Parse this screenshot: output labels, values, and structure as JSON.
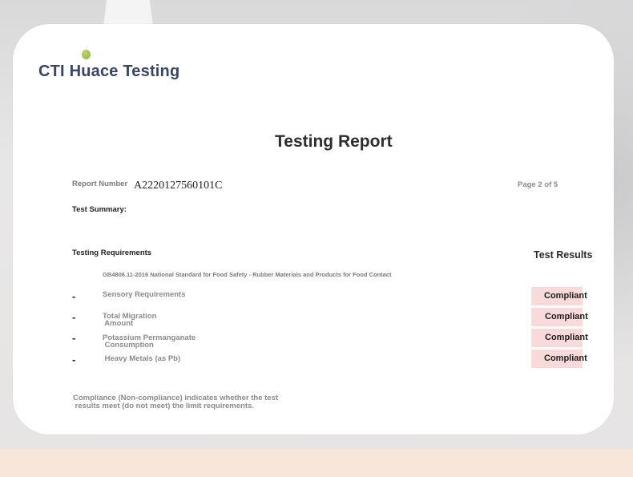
{
  "brand": {
    "name": "CTI Huace Testing",
    "logo_icon": "green-dot-icon",
    "brand_color": "#3a4466",
    "accent_color": "#8ab83a"
  },
  "report": {
    "title": "Testing Report",
    "number_label": "Report Number",
    "number_value": "A2220127560101C",
    "page_indicator": "Page 2 of 5",
    "summary_label": "Test Summary:",
    "requirements_label": "Testing Requirements",
    "results_label": "Test Results",
    "standard": "GB4806.11-2016 National Standard for Food Safety - Rubber Materials and Products for Food Contact",
    "requirements": [
      {
        "bullet": "-",
        "label": "Sensory Requirements",
        "result": "Compliant"
      },
      {
        "bullet": "-",
        "label": "Total Migration\n Amount",
        "result": "Compliant"
      },
      {
        "bullet": "-",
        "label": "Potassium Permanganate\n Consumption",
        "result": "Compliant"
      },
      {
        "bullet": "-",
        "label": " Heavy Metals (as Pb)",
        "result": "Compliant"
      }
    ],
    "footnote": "Compliance (Non-compliance) indicates whether the test\n results meet (do not meet) the limit requirements.",
    "result_badge_color": "#f9dada"
  }
}
